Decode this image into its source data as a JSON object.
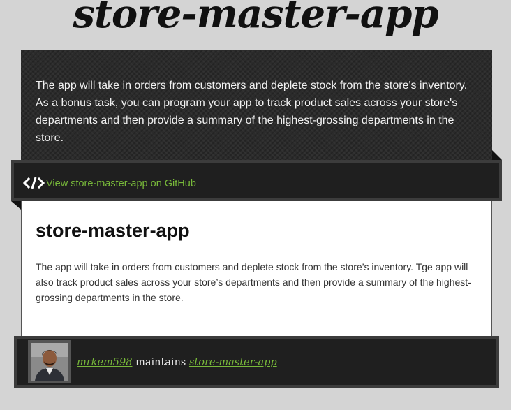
{
  "site_title": "store-master-app",
  "header": {
    "description": "The app will take in orders from customers and deplete stock from the store's inventory. As a bonus task, you can program your app to track product sales across your store's departments and then provide a summary of the highest-grossing departments in the store."
  },
  "ribbon": {
    "icon": "code-icon",
    "link_text": "View store-master-app on GitHub"
  },
  "content": {
    "title": "store-master-app",
    "description": "The app will take in orders from customers and deplete stock from the store’s inventory. Tge app will also track product sales across your store’s departments and then provide a summary of the highest-grossing departments in the store."
  },
  "footer": {
    "username": "mrkem598",
    "maintains_text": " maintains ",
    "repo_name": "store-master-app"
  },
  "colors": {
    "accent_green": "#78b93a",
    "dark_panel": "#1f1f1f",
    "page_bg": "#d4d4d4"
  }
}
